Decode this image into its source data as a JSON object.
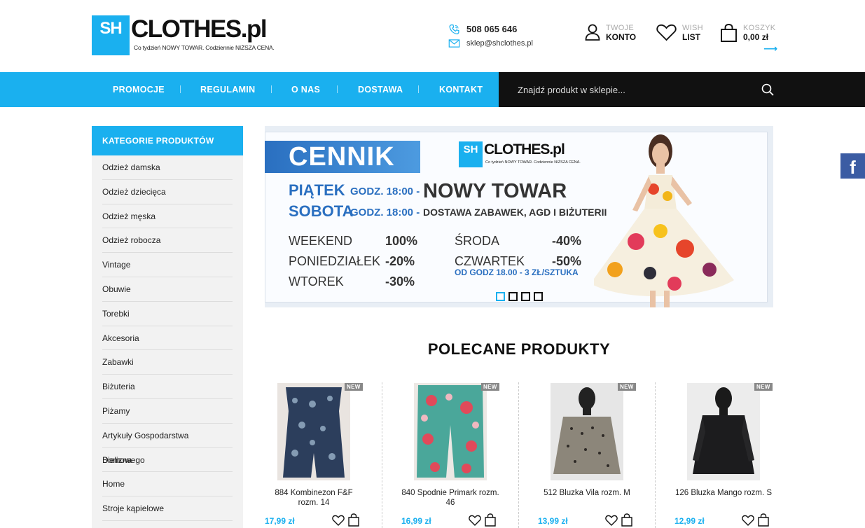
{
  "header": {
    "logo_box": "SH",
    "logo_name": "CLOTHES.pl",
    "tagline": "Co tydzień NOWY TOWAR. Codziennie NIŻSZA CENA.",
    "phone": "508 065 646",
    "email": "sklep@shclothes.pl",
    "account_small": "TWOJE",
    "account_big": "KONTO",
    "wish_small": "WISH",
    "wish_big": "LIST",
    "cart_small": "KOSZYK",
    "cart_big": "0,00 zł",
    "accent": "#1ab0ef"
  },
  "nav": {
    "items": [
      "PROMOCJE",
      "REGULAMIN",
      "O NAS",
      "DOSTAWA",
      "KONTAKT"
    ]
  },
  "search": {
    "placeholder": "Znajdź produkt w sklepie..."
  },
  "sidebar": {
    "title": "KATEGORIE PRODUKTÓW",
    "items": [
      "Odzież damska",
      "Odzież dziecięca",
      "Odzież męska",
      "Odzież robocza",
      "Vintage",
      "Obuwie",
      "Torebki",
      "Akcesoria",
      "Zabawki",
      "Biżuteria",
      "Piżamy",
      "Artykuły Gospodarstwa Domowego",
      "Bielizna",
      "Home",
      "Stroje kąpielowe"
    ]
  },
  "banner": {
    "cennik": "CENNIK",
    "logo_box": "SH",
    "logo_name": "CLOTHES.pl",
    "logo_tag": "Co tydzień NOWY TOWAR. Codziennie NIŻSZA CENA.",
    "line1_day": "PIĄTEK",
    "line1_time": "GODZ. 18:00 -",
    "line1_text": "NOWY TOWAR",
    "line2_day": "SOBOTA",
    "line2_time": "GODZ. 18:00 -",
    "line2_text": "DOSTAWA ZABAWEK, AGD I BIŻUTERII",
    "weekend": "WEEKEND",
    "weekend_val": "100%",
    "pon": "PONIEDZIAŁEK",
    "pon_val": "-20%",
    "wt": "WTOREK",
    "wt_val": "-30%",
    "sr": "ŚRODA",
    "sr_val": "-40%",
    "czw": "CZWARTEK",
    "czw_val": "-50%",
    "czw_note": "OD GODZ 18.00 - 3 ZŁ/SZTUKA",
    "slides": 4,
    "active_slide": 1
  },
  "facebook": "f",
  "products": {
    "title": "POLECANE PRODUKTY",
    "badge": "NEW",
    "items": [
      {
        "name": "884 Kombinezon F&F rozm. 14",
        "price": "17,99 zł"
      },
      {
        "name": "840 Spodnie Primark rozm. 46",
        "price": "16,99 zł"
      },
      {
        "name": "512 Bluzka Vila rozm. M",
        "price": "13,99 zł"
      },
      {
        "name": "126 Bluzka Mango rozm. S",
        "price": "12,99 zł"
      }
    ]
  }
}
